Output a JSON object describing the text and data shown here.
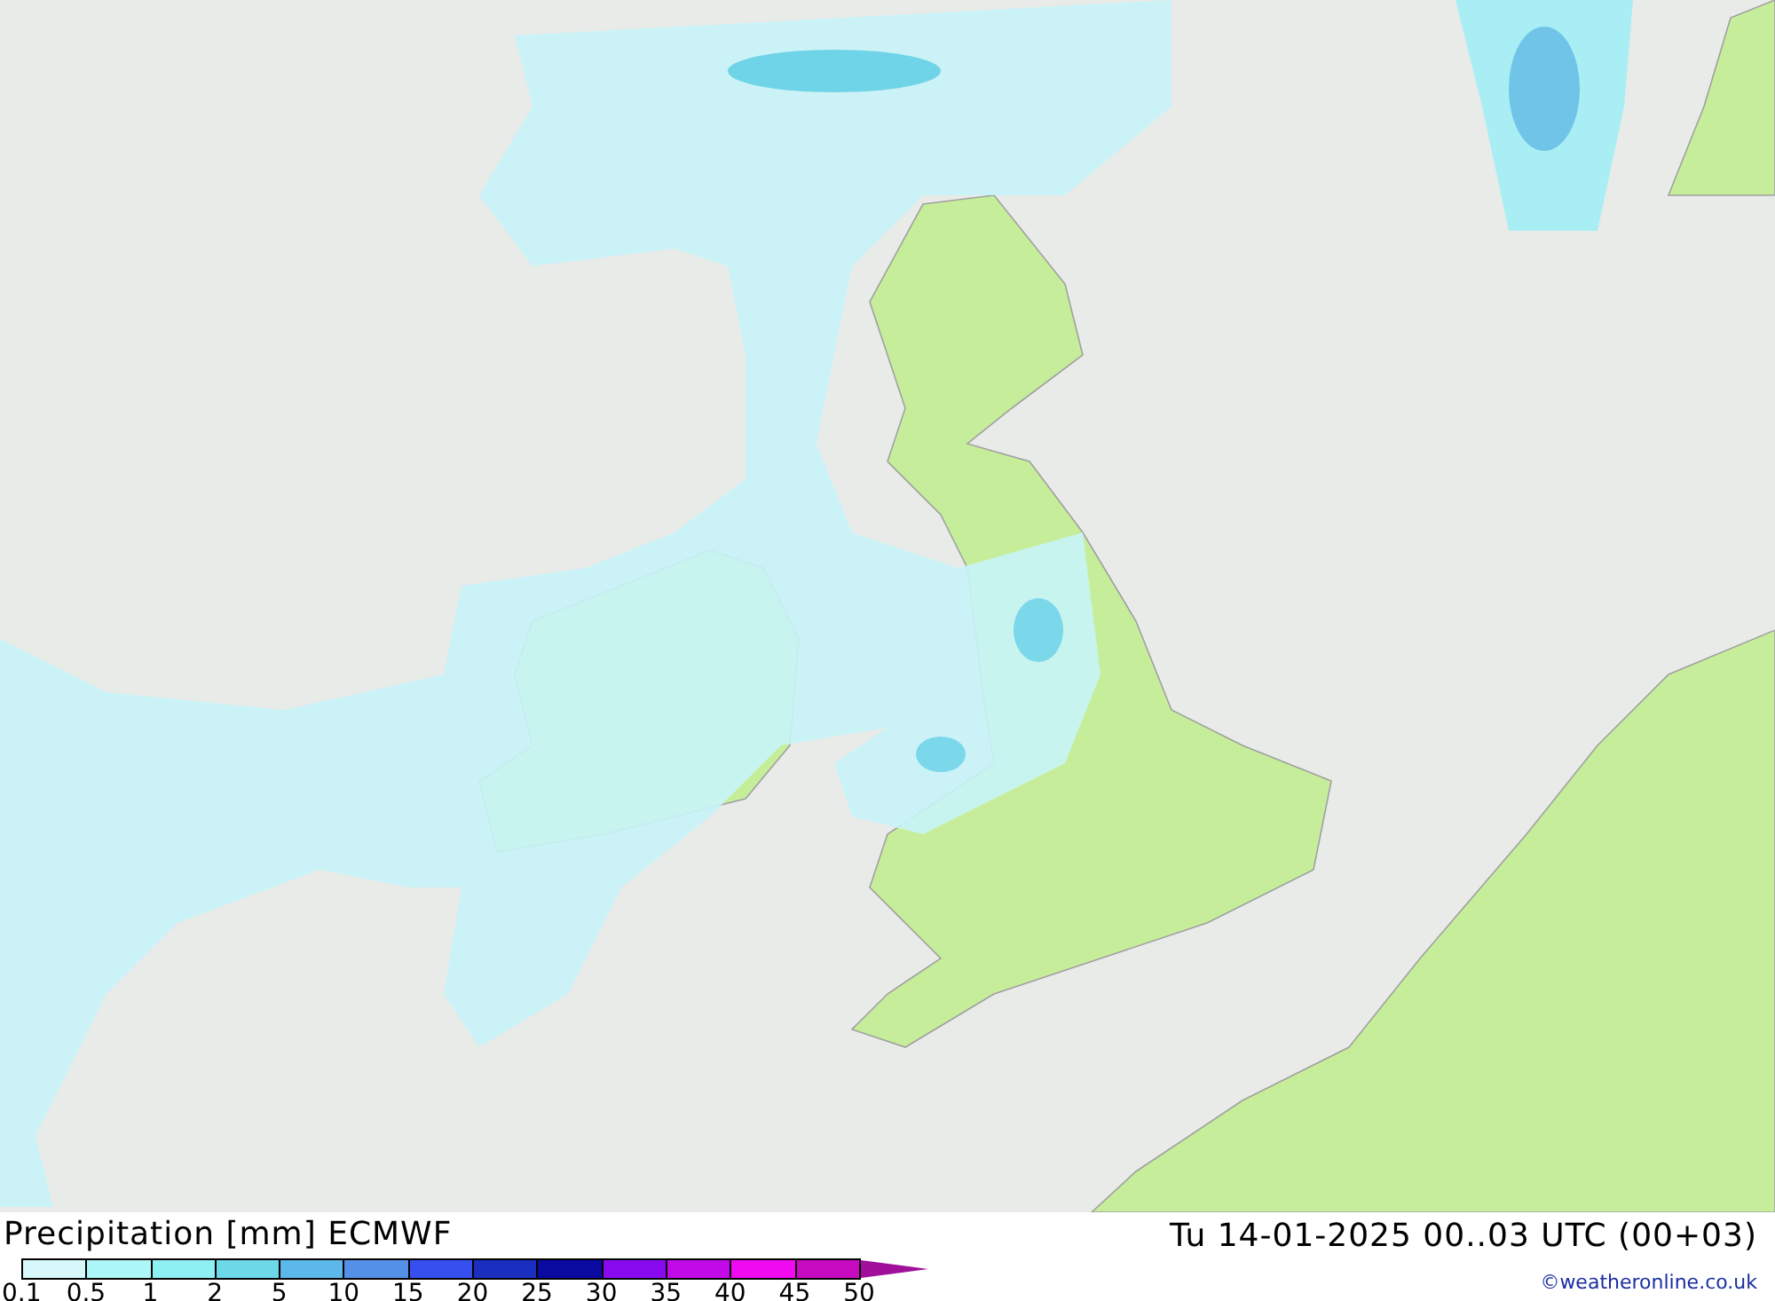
{
  "title": "Precipitation [mm] ECMWF",
  "valid_time": "Tu 14-01-2025 00..03 UTC (00+03)",
  "legend": {
    "swatches": [
      {
        "kind": "box",
        "color": "#d7f8fa"
      },
      {
        "kind": "box",
        "color": "#aef7f9"
      },
      {
        "kind": "box",
        "color": "#8ef0f2"
      },
      {
        "kind": "box",
        "color": "#6cd8e8"
      },
      {
        "kind": "box",
        "color": "#5cb8ea"
      },
      {
        "kind": "box",
        "color": "#5590e8"
      },
      {
        "kind": "box",
        "color": "#3650f0"
      },
      {
        "kind": "box",
        "color": "#1a2ec0"
      },
      {
        "kind": "box",
        "color": "#0a0aa0"
      },
      {
        "kind": "box",
        "color": "#8a0af0"
      },
      {
        "kind": "box",
        "color": "#c20ae8"
      },
      {
        "kind": "box",
        "color": "#f00af0"
      },
      {
        "kind": "box",
        "color": "#c80ac0"
      },
      {
        "kind": "arrow",
        "color": "#a0109a"
      }
    ],
    "ticks": [
      "0.1",
      "0.5",
      "1",
      "2",
      "5",
      "10",
      "15",
      "20",
      "25",
      "30",
      "35",
      "40",
      "45",
      "50"
    ]
  },
  "credit": "©weatheronline.co.uk"
}
